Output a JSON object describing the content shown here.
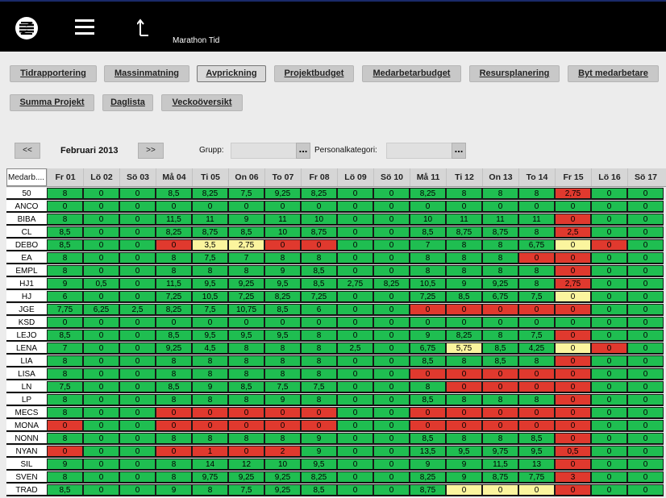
{
  "app": {
    "title": "Marathon Tid"
  },
  "nav": {
    "buttons": [
      "Tidrapportering",
      "Massinmatning",
      "Avprickning",
      "Projektbudget",
      "Medarbetarbudget",
      "Resursplanering",
      "Byt medarbetare",
      "Summa Projekt",
      "Daglista",
      "Veckoöversikt"
    ],
    "active": "Avprickning"
  },
  "period": {
    "prev": "<<",
    "next": ">>",
    "label": "Februari 2013"
  },
  "filters": {
    "group_label": "Grupp:",
    "group_value": "",
    "category_label": "Personalkategori:",
    "category_value": "",
    "dots": "..."
  },
  "grid": {
    "name_header": "Medarb....",
    "days": [
      "Fr 01",
      "Lö 02",
      "Sö 03",
      "Må 04",
      "Ti 05",
      "On 06",
      "To 07",
      "Fr 08",
      "Lö 09",
      "Sö 10",
      "Må 11",
      "Ti 12",
      "On 13",
      "To 14",
      "Fr 15",
      "Lö 16",
      "Sö 17"
    ],
    "colors": {
      "green": "#1fbe51",
      "red": "#e0392e",
      "yellow": "#fbf59e"
    },
    "rows": [
      {
        "name": "50",
        "values": [
          "8",
          "0",
          "0",
          "8,5",
          "8,25",
          "7,5",
          "9,25",
          "8,25",
          "0",
          "0",
          "8,25",
          "8",
          "8",
          "8",
          "2,75",
          "0",
          "0"
        ],
        "status": "ggggggggggggggrgg"
      },
      {
        "name": "ANCO",
        "values": [
          "0",
          "0",
          "0",
          "0",
          "0",
          "0",
          "0",
          "0",
          "0",
          "0",
          "0",
          "0",
          "0",
          "0",
          "0",
          "0",
          "0"
        ],
        "status": "ggggggggggggggggg"
      },
      {
        "name": "BIBA",
        "values": [
          "8",
          "0",
          "0",
          "11,5",
          "11",
          "9",
          "11",
          "10",
          "0",
          "0",
          "10",
          "11",
          "11",
          "11",
          "0",
          "0",
          "0"
        ],
        "status": "ggggggggggggggrgg"
      },
      {
        "name": "CL",
        "values": [
          "8,5",
          "0",
          "0",
          "8,25",
          "8,75",
          "8,5",
          "10",
          "8,75",
          "0",
          "0",
          "8,5",
          "8,75",
          "8,75",
          "8",
          "2,5",
          "0",
          "0"
        ],
        "status": "ggggggggggggggrgg"
      },
      {
        "name": "DEBO",
        "values": [
          "8,5",
          "0",
          "0",
          "0",
          "3,5",
          "2,75",
          "0",
          "0",
          "0",
          "0",
          "7",
          "8",
          "8",
          "6,75",
          "0",
          "0",
          "0"
        ],
        "status": "gggryyrrggggggyrgg"
      },
      {
        "name": "EA",
        "values": [
          "8",
          "0",
          "0",
          "8",
          "7,5",
          "7",
          "8",
          "8",
          "0",
          "0",
          "8",
          "8",
          "8",
          "0",
          "0",
          "0",
          "0"
        ],
        "status": "gggggggggggggrrgg"
      },
      {
        "name": "EMPL",
        "values": [
          "8",
          "0",
          "0",
          "8",
          "8",
          "8",
          "9",
          "8,5",
          "0",
          "0",
          "8",
          "8",
          "8",
          "8",
          "0",
          "0",
          "0"
        ],
        "status": "ggggggggggggggrgg"
      },
      {
        "name": "HJ1",
        "values": [
          "9",
          "0,5",
          "0",
          "11,5",
          "9,5",
          "9,25",
          "9,5",
          "8,5",
          "2,75",
          "8,25",
          "10,5",
          "9",
          "9,25",
          "8",
          "2,75",
          "0",
          "0"
        ],
        "status": "ggggggggggggggrgg"
      },
      {
        "name": "HJ",
        "values": [
          "6",
          "0",
          "0",
          "7,25",
          "10,5",
          "7,25",
          "8,25",
          "7,25",
          "0",
          "0",
          "7,25",
          "8,5",
          "6,75",
          "7,5",
          "0",
          "0",
          "0"
        ],
        "status": "ggggggggggggggygg"
      },
      {
        "name": "JGE",
        "values": [
          "7,75",
          "6,25",
          "2,5",
          "8,25",
          "7,5",
          "10,75",
          "8,5",
          "6",
          "0",
          "0",
          "0",
          "0",
          "0",
          "0",
          "0",
          "0",
          "0"
        ],
        "status": "ggggggggggrrrrrgg"
      },
      {
        "name": "KSD",
        "values": [
          "0",
          "0",
          "0",
          "0",
          "0",
          "0",
          "0",
          "0",
          "0",
          "0",
          "0",
          "0",
          "0",
          "0",
          "0",
          "0",
          "0"
        ],
        "status": "ggggggggggggggggg"
      },
      {
        "name": "LEJO",
        "values": [
          "8,5",
          "0",
          "0",
          "8,5",
          "9,5",
          "9,5",
          "9,5",
          "8",
          "0",
          "0",
          "9",
          "8,25",
          "8",
          "7,5",
          "0",
          "0",
          "0"
        ],
        "status": "ggggggggggggggrgg"
      },
      {
        "name": "LENA",
        "values": [
          "7",
          "0",
          "0",
          "9,25",
          "4,5",
          "8",
          "8",
          "8",
          "2,5",
          "0",
          "6,75",
          "5,75",
          "8,5",
          "4,25",
          "0",
          "0",
          "0"
        ],
        "status": "gggggggggggyggyrgg"
      },
      {
        "name": "LIA",
        "values": [
          "8",
          "0",
          "0",
          "8",
          "8",
          "8",
          "8",
          "8",
          "0",
          "0",
          "8,5",
          "8",
          "8,5",
          "8",
          "0",
          "0",
          "0"
        ],
        "status": "ggggggggggggggrgg"
      },
      {
        "name": "LISA",
        "values": [
          "8",
          "0",
          "0",
          "8",
          "8",
          "8",
          "8",
          "8",
          "0",
          "0",
          "0",
          "0",
          "0",
          "0",
          "0",
          "0",
          "0"
        ],
        "status": "ggggggggggrrrrrgg"
      },
      {
        "name": "LN",
        "values": [
          "7,5",
          "0",
          "0",
          "8,5",
          "9",
          "8,5",
          "7,5",
          "7,5",
          "0",
          "0",
          "8",
          "0",
          "0",
          "0",
          "0",
          "0",
          "0"
        ],
        "status": "gggggggggggrrrrgg"
      },
      {
        "name": "LP",
        "values": [
          "8",
          "0",
          "0",
          "8",
          "8",
          "8",
          "9",
          "8",
          "0",
          "0",
          "8,5",
          "8",
          "8",
          "8",
          "0",
          "0",
          "0"
        ],
        "status": "ggggggggggggggrgg"
      },
      {
        "name": "MECS",
        "values": [
          "8",
          "0",
          "0",
          "0",
          "0",
          "0",
          "0",
          "0",
          "0",
          "0",
          "0",
          "0",
          "0",
          "0",
          "0",
          "0",
          "0"
        ],
        "status": "gggrrrrrggrrrrrgg"
      },
      {
        "name": "MONA",
        "values": [
          "0",
          "0",
          "0",
          "0",
          "0",
          "0",
          "0",
          "0",
          "0",
          "0",
          "0",
          "0",
          "0",
          "0",
          "0",
          "0",
          "0"
        ],
        "status": "rggrrrrrggrrrrrgg"
      },
      {
        "name": "NONN",
        "values": [
          "8",
          "0",
          "0",
          "8",
          "8",
          "8",
          "8",
          "9",
          "0",
          "0",
          "8,5",
          "8",
          "8",
          "8,5",
          "0",
          "0",
          "0"
        ],
        "status": "ggggggggggggggrgg"
      },
      {
        "name": "NYAN",
        "values": [
          "0",
          "0",
          "0",
          "0",
          "1",
          "0",
          "2",
          "9",
          "0",
          "0",
          "13,5",
          "9,5",
          "9,75",
          "9,5",
          "0,5",
          "0",
          "0"
        ],
        "status": "rggrrrrgggggggrgg"
      },
      {
        "name": "SIL",
        "values": [
          "9",
          "0",
          "0",
          "8",
          "14",
          "12",
          "10",
          "9,5",
          "0",
          "0",
          "9",
          "9",
          "11,5",
          "13",
          "0",
          "0",
          "0"
        ],
        "status": "ggggggggggggggrgg"
      },
      {
        "name": "SVEN",
        "values": [
          "8",
          "0",
          "0",
          "8",
          "9,75",
          "9,25",
          "9,25",
          "8,25",
          "0",
          "0",
          "8,25",
          "9",
          "8,75",
          "7,75",
          "3",
          "0",
          "0"
        ],
        "status": "ggggggggggggggrgg"
      },
      {
        "name": "TRAD",
        "values": [
          "8,5",
          "0",
          "0",
          "9",
          "8",
          "7,5",
          "9,25",
          "8,5",
          "0",
          "0",
          "8,75",
          "0",
          "0",
          "0",
          "0",
          "0",
          "0"
        ],
        "status": "gggggggggggyyyrgg"
      }
    ]
  }
}
